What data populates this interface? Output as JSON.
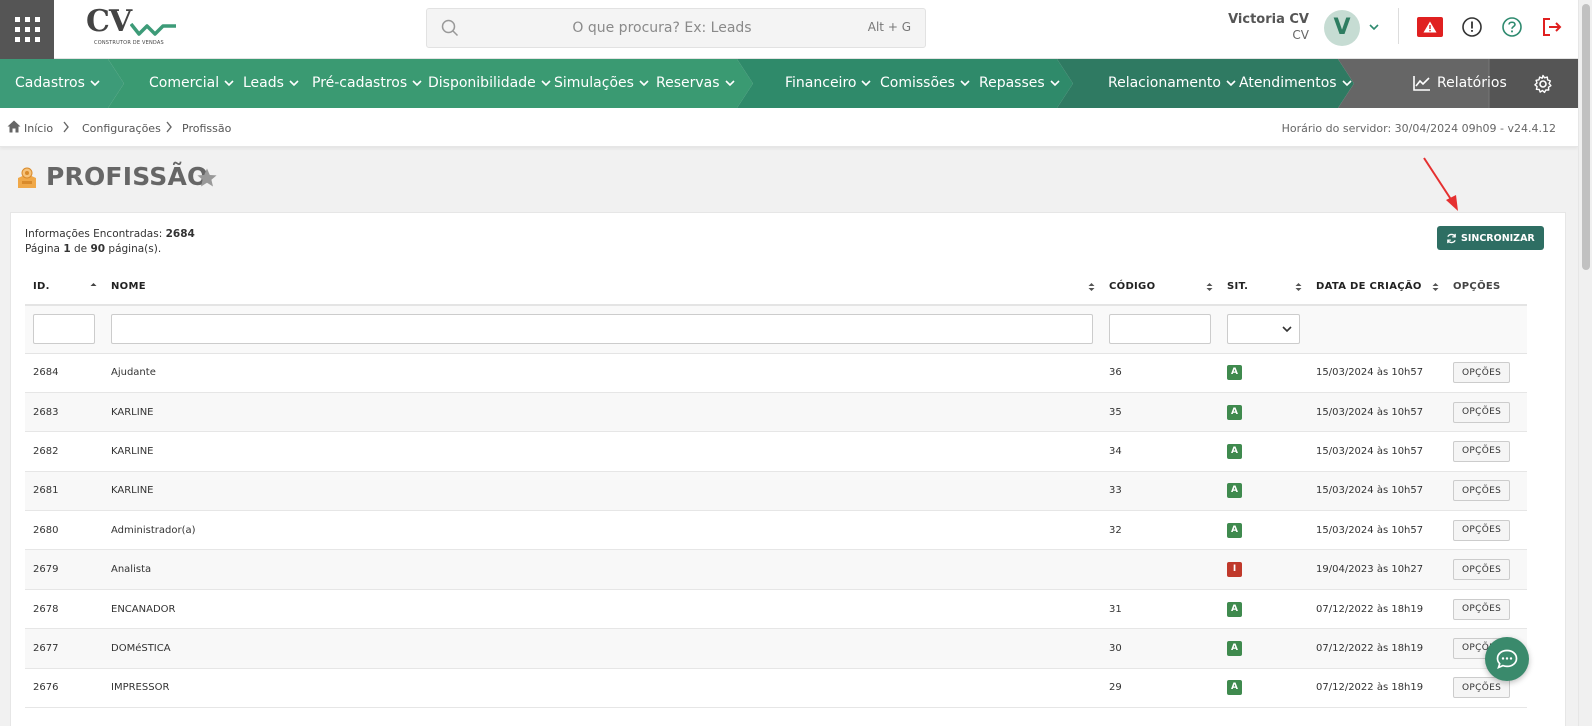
{
  "header": {
    "logo_text": "CV",
    "logo_subtitle": "CONSTRUTOR DE VENDAS",
    "search": {
      "placeholder": "O que procura? Ex: Leads",
      "shortcut": "Alt + G"
    },
    "user": {
      "name": "Victoria CV",
      "company": "CV",
      "avatar_letter": "V"
    },
    "icons": [
      "apps-grid-icon",
      "alert-icon",
      "info-icon",
      "help-icon",
      "logout-icon"
    ],
    "colors": {
      "alert": "#e02020",
      "logout": "#e02020",
      "help": "#2e8a6f",
      "avatar_bg": "#c6dcd3"
    }
  },
  "nav": {
    "items": [
      {
        "label": "Cadastros",
        "key": "cadastros"
      },
      {
        "label": "Comercial",
        "key": "comercial"
      },
      {
        "label": "Leads",
        "key": "leads"
      },
      {
        "label": "Pré-cadastros",
        "key": "pre-cadastros"
      },
      {
        "label": "Disponibilidade",
        "key": "disponibilidade"
      },
      {
        "label": "Simulações",
        "key": "simulacoes"
      },
      {
        "label": "Reservas",
        "key": "reservas"
      },
      {
        "label": "Financeiro",
        "key": "financeiro"
      },
      {
        "label": "Comissões",
        "key": "comissoes"
      },
      {
        "label": "Repasses",
        "key": "repasses"
      },
      {
        "label": "Relacionamento",
        "key": "relacionamento"
      },
      {
        "label": "Atendimentos",
        "key": "atendimentos"
      }
    ],
    "reports_label": "Relatórios",
    "colors": [
      "#3d9b78",
      "#3a9a72",
      "#2f8a6a",
      "#2f7a62",
      "#666666",
      "#555555"
    ]
  },
  "breadcrumb": {
    "items": [
      "Início",
      "Configurações",
      "Profissão"
    ],
    "server_time": "Horário do servidor: 30/04/2024 09h09 - v24.4.12"
  },
  "page": {
    "title": "PROFISSÃO",
    "info_label": "Informações Encontradas:",
    "info_count": "2684",
    "page_label_1": "Página",
    "page_current": "1",
    "page_label_2": "de",
    "page_total": "90",
    "page_label_3": "página(s).",
    "sync_label": "SINCRONIZAR"
  },
  "table": {
    "columns": [
      "ID.",
      "NOME",
      "CÓDIGO",
      "SIT.",
      "DATA DE CRIAÇÃO",
      "OPÇÕES"
    ],
    "option_label": "OPÇÕES",
    "rows": [
      {
        "id": "2684",
        "nome": "Ajudante",
        "codigo": "36",
        "sit": "A",
        "data": "15/03/2024 às 10h57"
      },
      {
        "id": "2683",
        "nome": "KARLINE",
        "codigo": "35",
        "sit": "A",
        "data": "15/03/2024 às 10h57"
      },
      {
        "id": "2682",
        "nome": "KARLINE",
        "codigo": "34",
        "sit": "A",
        "data": "15/03/2024 às 10h57"
      },
      {
        "id": "2681",
        "nome": "KARLINE",
        "codigo": "33",
        "sit": "A",
        "data": "15/03/2024 às 10h57"
      },
      {
        "id": "2680",
        "nome": "Administrador(a)",
        "codigo": "32",
        "sit": "A",
        "data": "15/03/2024 às 10h57"
      },
      {
        "id": "2679",
        "nome": "Analista",
        "codigo": "",
        "sit": "I",
        "data": "19/04/2023 às 10h27"
      },
      {
        "id": "2678",
        "nome": "ENCANADOR",
        "codigo": "31",
        "sit": "A",
        "data": "07/12/2022 às 18h19"
      },
      {
        "id": "2677",
        "nome": "DOMéSTICA",
        "codigo": "30",
        "sit": "A",
        "data": "07/12/2022 às 18h19"
      },
      {
        "id": "2676",
        "nome": "IMPRESSOR",
        "codigo": "29",
        "sit": "A",
        "data": "07/12/2022 às 18h19"
      }
    ],
    "status_colors": {
      "A": "#3f8a4e",
      "I": "#c0392b"
    }
  }
}
